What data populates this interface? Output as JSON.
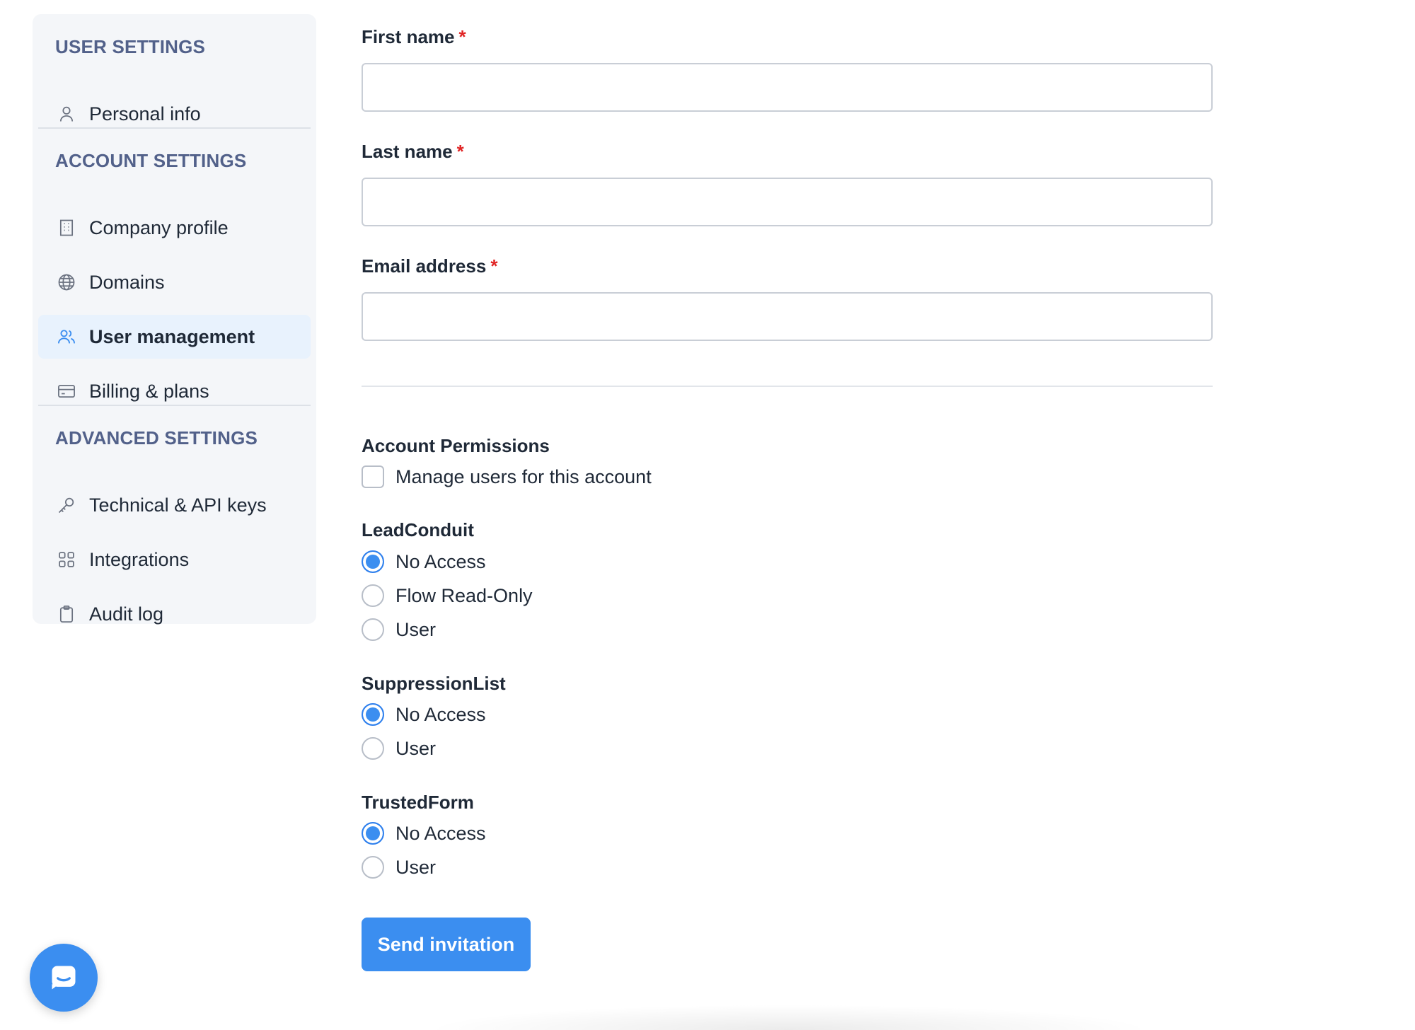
{
  "sidebar": {
    "sections": [
      {
        "heading": "USER SETTINGS",
        "items": [
          {
            "label": "Personal info",
            "icon": "user-icon"
          }
        ]
      },
      {
        "heading": "ACCOUNT SETTINGS",
        "items": [
          {
            "label": "Company profile",
            "icon": "building-icon"
          },
          {
            "label": "Domains",
            "icon": "globe-icon"
          },
          {
            "label": "User management",
            "icon": "users-icon",
            "active": true
          },
          {
            "label": "Billing & plans",
            "icon": "credit-card-icon"
          }
        ]
      },
      {
        "heading": "ADVANCED SETTINGS",
        "items": [
          {
            "label": "Technical & API keys",
            "icon": "key-icon"
          },
          {
            "label": "Integrations",
            "icon": "grid-icon"
          },
          {
            "label": "Audit log",
            "icon": "clipboard-icon"
          }
        ]
      }
    ]
  },
  "form": {
    "first_name": {
      "label": "First name",
      "required_mark": "*",
      "value": "",
      "placeholder": ""
    },
    "last_name": {
      "label": "Last name",
      "required_mark": "*",
      "value": "",
      "placeholder": ""
    },
    "email": {
      "label": "Email address",
      "required_mark": "*",
      "value": "",
      "placeholder": ""
    },
    "account_permissions": {
      "title": "Account Permissions",
      "checkbox_label": "Manage users for this account",
      "checked": false
    },
    "leadconduit": {
      "title": "LeadConduit",
      "options": [
        "No Access",
        "Flow Read-Only",
        "User"
      ],
      "selected": "No Access"
    },
    "suppressionlist": {
      "title": "SuppressionList",
      "options": [
        "No Access",
        "User"
      ],
      "selected": "No Access"
    },
    "trustedform": {
      "title": "TrustedForm",
      "options": [
        "No Access",
        "User"
      ],
      "selected": "No Access"
    },
    "submit_label": "Send invitation"
  },
  "colors": {
    "accent": "#3b8ef0",
    "section_heading": "#52618a",
    "required": "#e02424",
    "sidebar_bg": "#f4f6f9",
    "active_bg": "#e8f2fd"
  },
  "chat_launcher": {
    "icon": "chat-icon"
  }
}
